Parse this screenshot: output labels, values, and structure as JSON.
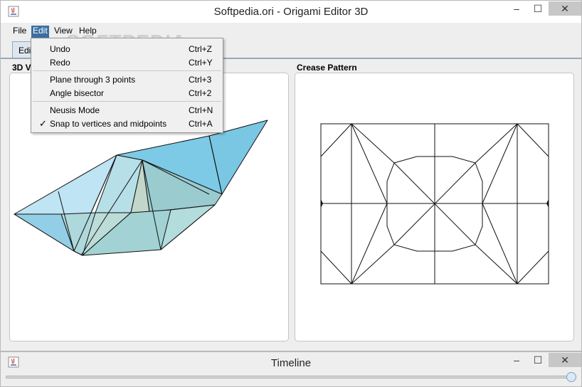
{
  "window": {
    "title": "Softpedia.ori - Origami Editor 3D",
    "minimize": "‒",
    "maximize": "☐",
    "close": "✕"
  },
  "menubar": {
    "items": [
      {
        "label": "File"
      },
      {
        "label": "Edit"
      },
      {
        "label": "View"
      },
      {
        "label": "Help"
      }
    ],
    "active": "Edit"
  },
  "tabs": [
    {
      "label": "Edi"
    }
  ],
  "panels": {
    "left_label": "3D V",
    "right_label": "Crease Pattern"
  },
  "edit_menu": {
    "items": [
      {
        "label": "Undo",
        "shortcut": "Ctrl+Z"
      },
      {
        "label": "Redo",
        "shortcut": "Ctrl+Y"
      },
      {
        "label": "Plane through 3 points",
        "shortcut": "Ctrl+3"
      },
      {
        "label": "Angle bisector",
        "shortcut": "Ctrl+2"
      },
      {
        "label": "Neusis Mode",
        "shortcut": "Ctrl+N"
      },
      {
        "label": "Snap to vertices and midpoints",
        "shortcut": "Ctrl+A",
        "checked": true,
        "check_mark": "✓"
      }
    ]
  },
  "watermark": "SOFTPEDIA",
  "timeline": {
    "title": "Timeline",
    "minimize": "‒",
    "maximize": "☐",
    "close": "✕",
    "position": 1.0
  },
  "colors": {
    "menu_highlight": "#3c6fa0",
    "model_top": "#7cc8e4",
    "model_side": "#9fcfd0"
  }
}
